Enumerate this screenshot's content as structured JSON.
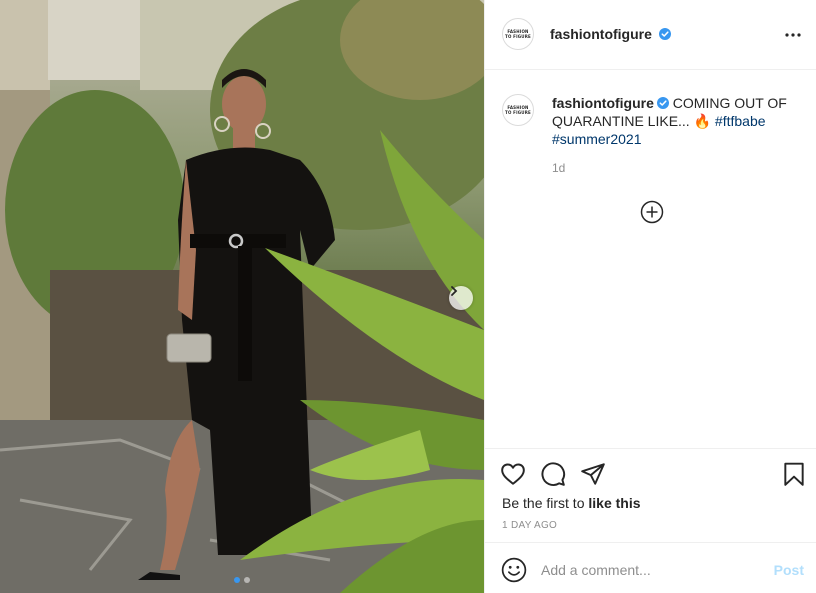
{
  "post": {
    "username": "fashiontofigure",
    "avatar_text_line1": "FASHION",
    "avatar_text_line2": "TO FIGURE",
    "verified": true,
    "more_icon": "more-horizontal-icon"
  },
  "caption": {
    "username": "fashiontofigure",
    "text": "COMING OUT OF QUARANTINE LIKE...",
    "emoji": "🔥",
    "hashtag_1": "#ftfbabe",
    "hashtag_2": "#summer2021",
    "age": "1d",
    "load_more_icon": "plus-circle-icon"
  },
  "actions": {
    "icons": [
      "heart-icon",
      "comment-icon",
      "share-icon",
      "bookmark-icon"
    ],
    "likes_prefix": "Be the first to",
    "likes_bold": "like this",
    "date": "1 DAY AGO"
  },
  "comment": {
    "emoji_icon": "smiley-icon",
    "placeholder": "Add a comment...",
    "post_label": "Post"
  },
  "carousel": {
    "slide_count": 2,
    "active_slide": 1,
    "next_icon": "chevron-right-icon"
  },
  "colors": {
    "verified_blue": "#3897f0",
    "hashtag": "#00376b",
    "post_disabled": "#b2dffc",
    "secondary_text": "#8e8e8e",
    "divider": "#efefef"
  }
}
